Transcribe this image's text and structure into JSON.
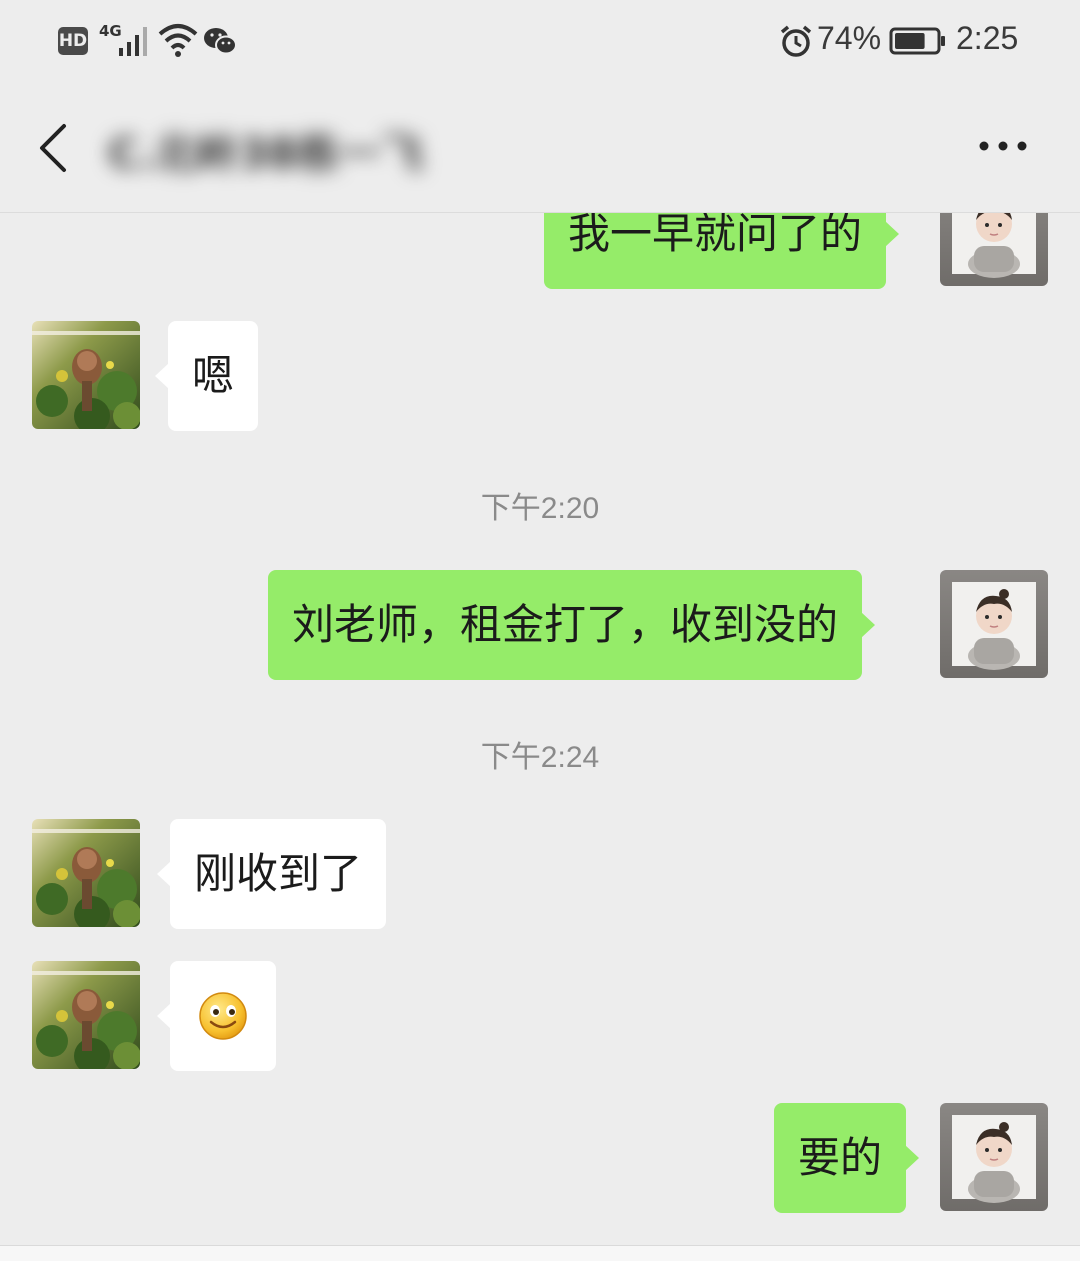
{
  "status_bar": {
    "hd_label": "HD",
    "network_label": "4G",
    "battery_percent": "74%",
    "battery_level": 0.74,
    "time": "2:25",
    "icons": [
      "signal-icon",
      "wifi-icon",
      "wechat-icon",
      "alarm-icon",
      "battery-icon"
    ]
  },
  "header": {
    "back_icon": "back-chevron-icon",
    "title": "C.北岭38栋一飞",
    "more_icon": "more-dots-icon"
  },
  "messages": [
    {
      "side": "out",
      "text": "我一早就问了的"
    },
    {
      "side": "in",
      "text": "嗯"
    },
    {
      "type": "time",
      "text": "下午2:20"
    },
    {
      "side": "out",
      "text": "刘老师，租金打了，收到没的"
    },
    {
      "type": "time",
      "text": "下午2:24"
    },
    {
      "side": "in",
      "text": "刚收到了"
    },
    {
      "side": "in",
      "emoji": "smile-emoji"
    },
    {
      "side": "out",
      "text": "要的"
    }
  ],
  "colors": {
    "background": "#ededed",
    "outgoing_bubble": "#95ec69",
    "incoming_bubble": "#ffffff",
    "timestamp_text": "#8a8a8a"
  }
}
